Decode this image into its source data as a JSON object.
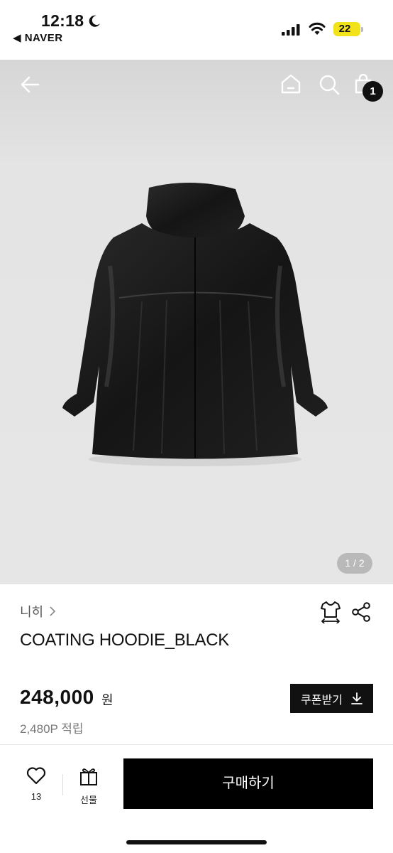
{
  "status_bar": {
    "time": "12:18",
    "back_app": "◀ NAVER",
    "battery": "22",
    "battery_color": "#f2e21a"
  },
  "header": {
    "cart_count": "1"
  },
  "gallery": {
    "page_indicator": "1 / 2"
  },
  "product": {
    "brand": "니히",
    "title": "COATING HOODIE_BLACK",
    "price": "248,000",
    "currency": "원",
    "points": "2,480P 적립",
    "coupon_label": "쿠폰받기"
  },
  "bottom_bar": {
    "like_count": "13",
    "gift_label": "선물",
    "buy_label": "구매하기"
  },
  "icons": [
    "moon-icon",
    "signal-icon",
    "wifi-icon",
    "back-arrow-icon",
    "home-icon",
    "search-icon",
    "shopping-bag-icon",
    "size-guide-icon",
    "share-icon",
    "heart-icon",
    "gift-icon",
    "download-icon",
    "chevron-right-icon"
  ]
}
